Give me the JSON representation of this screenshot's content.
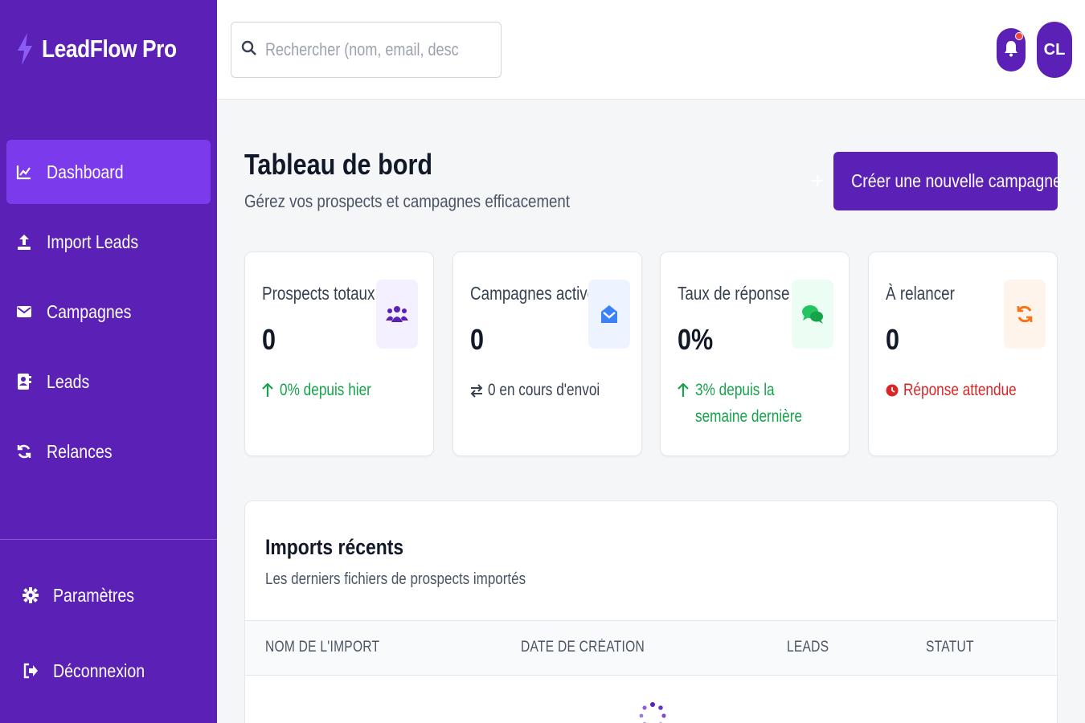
{
  "app": {
    "name": "LeadFlow Pro"
  },
  "sidebar": {
    "items": [
      {
        "label": "Dashboard",
        "icon": "chart-line-icon",
        "active": true
      },
      {
        "label": "Import Leads",
        "icon": "upload-icon",
        "active": false
      },
      {
        "label": "Campagnes",
        "icon": "envelope-icon",
        "active": false
      },
      {
        "label": "Leads",
        "icon": "address-book-icon",
        "active": false
      },
      {
        "label": "Relances",
        "icon": "sync-icon",
        "active": false
      }
    ],
    "bottom": [
      {
        "label": "Paramètres",
        "icon": "gear-icon"
      },
      {
        "label": "Déconnexion",
        "icon": "sign-out-icon"
      }
    ]
  },
  "header": {
    "search": {
      "placeholder": "Rechercher (nom, email, description, s",
      "value": ""
    },
    "avatar_initials": "CL"
  },
  "page": {
    "title": "Tableau de bord",
    "subtitle": "Gérez vos prospects et campagnes efficacement",
    "cta_label": "Créer une nouvelle campagne"
  },
  "stats": [
    {
      "title": "Prospects totaux",
      "value": "0",
      "footer": "0% depuis hier",
      "footer_color": "#16a34a",
      "icon": "users-icon",
      "icon_bg": "#f5f0ff",
      "icon_color": "#5b21b6"
    },
    {
      "title": "Campagnes actives",
      "value": "0",
      "footer": "0 en cours d'envoi",
      "footer_color": "#374151",
      "icon": "envelope-open-icon",
      "icon_bg": "#eef4ff",
      "icon_color": "#3b82f6"
    },
    {
      "title": "Taux de réponse",
      "value": "0%",
      "footer": "3% depuis la semaine dernière",
      "footer_color": "#16a34a",
      "icon": "comments-icon",
      "icon_bg": "#ecfdf3",
      "icon_color": "#22c55e"
    },
    {
      "title": "À relancer",
      "value": "0",
      "footer": "Réponse attendue",
      "footer_color": "#dc2626",
      "icon": "sync-icon",
      "icon_bg": "#fff4ec",
      "icon_color": "#f97316"
    }
  ],
  "imports": {
    "title": "Imports récents",
    "subtitle": "Les derniers fichiers de prospects importés",
    "columns": [
      "NOM DE L'IMPORT",
      "DATE DE CRÉATION",
      "LEADS",
      "STATUT"
    ]
  }
}
